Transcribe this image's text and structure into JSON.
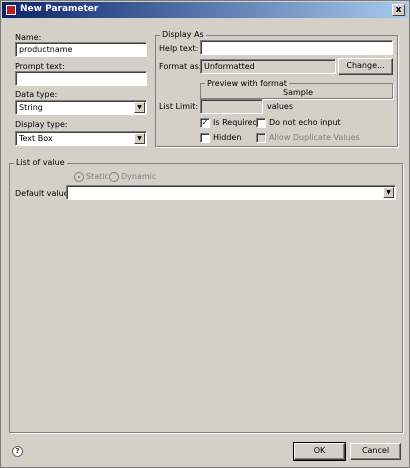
{
  "window": {
    "title": "New Parameter",
    "close": "x"
  },
  "left": {
    "name_label": "Name:",
    "name_value": "productname",
    "prompt_label": "Prompt text:",
    "prompt_value": "",
    "datatype_label": "Data type:",
    "datatype_value": "String",
    "displaytype_label": "Display type:",
    "displaytype_value": "Text Box"
  },
  "display_as": {
    "legend": "Display As",
    "help_label": "Help text:",
    "help_value": "",
    "format_label": "Format as:",
    "format_value": "Unformatted",
    "change_button": "Change...",
    "preview_legend": "Preview with format",
    "preview_value": "Sample",
    "list_limit_label": "List Limit:",
    "list_limit_value": "",
    "values_label": "values",
    "is_required_label": "Is Required",
    "is_required_checked": "✓",
    "no_echo_label": "Do not echo input",
    "hidden_label": "Hidden",
    "allow_dup_label": "Allow Duplicate Values"
  },
  "list_of_value": {
    "legend": "List of value",
    "static_label": "Static",
    "dynamic_label": "Dynamic",
    "default_label": "Default value:",
    "default_value": ""
  },
  "footer": {
    "help_icon": "?",
    "ok": "OK",
    "cancel": "Cancel"
  },
  "icons": {
    "dropdown": "▼"
  }
}
